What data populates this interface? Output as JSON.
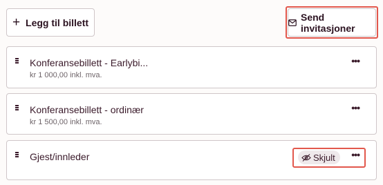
{
  "toolbar": {
    "add_label": "Legg til billett",
    "add_icon": "plus-icon",
    "send_label": "Send invitasjoner",
    "send_icon": "envelope-icon"
  },
  "tickets": [
    {
      "title": "Konferansebillett - Earlybi...",
      "price": "kr 1 000,00 inkl. mva.",
      "menu_icon": "more-horizontal-icon"
    },
    {
      "title": "Konferansebillett - ordinær",
      "price": "kr 1 500,00 inkl. mva.",
      "menu_icon": "more-horizontal-icon"
    },
    {
      "title": "Gjest/innleder",
      "status_badge": "Skjult",
      "status_icon": "eye-off-icon",
      "menu_icon": "more-horizontal-icon"
    }
  ],
  "colors": {
    "highlight": "#e2574c",
    "text": "#3a1a2a",
    "badge_bg": "#efe9eb"
  }
}
